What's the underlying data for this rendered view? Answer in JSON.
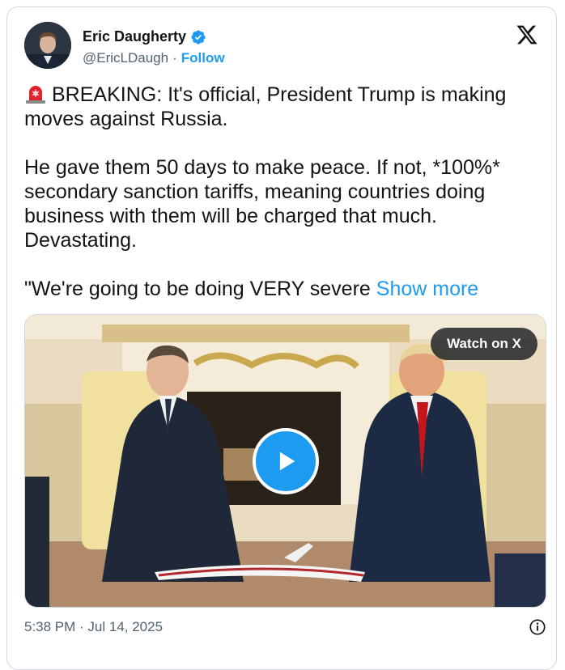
{
  "author": {
    "name": "Eric Daugherty",
    "handle": "@EricLDaugh",
    "separator": "·",
    "follow_label": "Follow",
    "verified": true
  },
  "icons": {
    "brand": "x-logo-icon",
    "verified": "verified-badge-icon",
    "siren": "rotating-light-emoji-icon",
    "play": "play-icon",
    "info": "info-icon"
  },
  "tweet": {
    "line1": "BREAKING: It's official, President Trump is making moves against Russia.",
    "line2": "He gave them 50 days to make peace. If not, *100%* secondary sanction tariffs, meaning countries doing business with them will be charged that much. Devastating.",
    "line3": "\"We're going to be doing VERY severe",
    "show_more": "Show more"
  },
  "media": {
    "watch_label": "Watch on X"
  },
  "footer": {
    "timestamp": "5:38 PM · Jul 14, 2025"
  },
  "colors": {
    "accent": "#1d9bf0",
    "text": "#0f1419",
    "muted": "#536471",
    "border": "#cfd9de"
  }
}
